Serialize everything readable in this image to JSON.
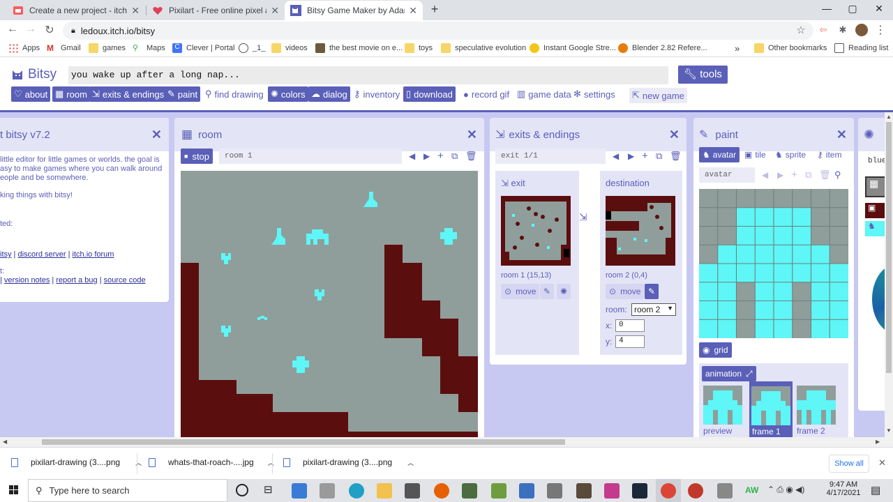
{
  "browser": {
    "tabs": [
      {
        "title": "Create a new project - itch.io",
        "icon": "itchio-icon",
        "active": false
      },
      {
        "title": "Pixilart - Free online pixel art drawing",
        "icon": "pixilart-heart-icon",
        "active": false
      },
      {
        "title": "Bitsy Game Maker by Adam Le Doux",
        "icon": "bitsy-cat-icon",
        "active": true
      }
    ],
    "url": "ledoux.itch.io/bitsy",
    "bookmarks": [
      "Apps",
      "Gmail",
      "games",
      "Maps",
      "Clever | Portal",
      "_1_",
      "videos",
      "the best movie on e...",
      "toys",
      "speculative evolution",
      "Instant Google Stre...",
      "Blender 2.82 Refere..."
    ],
    "overflow": "»",
    "other_bookmarks": "Other bookmarks",
    "reading_list": "Reading list"
  },
  "bitsy": {
    "logo": "Bitsy",
    "game_title": "you wake up after a long nap...",
    "tools": "tools",
    "menu": [
      {
        "label": "about",
        "icon": "heart-icon",
        "on": true
      },
      {
        "label": "room",
        "icon": "grid-icon",
        "on": true
      },
      {
        "label": "exits & endings",
        "icon": "exit-icon",
        "on": true
      },
      {
        "label": "paint",
        "icon": "brush-icon",
        "on": true
      },
      {
        "label": "find drawing",
        "icon": "magnify-icon",
        "on": false
      },
      {
        "label": "colors",
        "icon": "palette-icon",
        "on": true
      },
      {
        "label": "dialog",
        "icon": "speech-icon",
        "on": true
      },
      {
        "label": "inventory",
        "icon": "key-icon",
        "on": false
      },
      {
        "label": "download",
        "icon": "download-icon",
        "on": true
      },
      {
        "label": "record gif",
        "icon": "record-icon",
        "on": false
      },
      {
        "label": "game data",
        "icon": "data-icon",
        "on": false
      },
      {
        "label": "settings",
        "icon": "gear-icon",
        "on": false
      },
      {
        "label": "new game",
        "icon": "new-game-icon",
        "on": false
      }
    ]
  },
  "about": {
    "title": "t bitsy v7.2",
    "lines": [
      "little editor for little games or worlds. the goal is",
      "asy to make games where you can walk around",
      "eople and be somewhere.",
      "king things with bitsy!",
      "ted:"
    ],
    "links1": [
      "itsy",
      "discord server",
      "itch.io forum"
    ],
    "lines2": "t:",
    "links2": [
      "version notes",
      "report a bug",
      "source code"
    ]
  },
  "room": {
    "title": "room",
    "stop": "stop",
    "name": "room 1"
  },
  "exits": {
    "title": "exits & endings",
    "counter": "exit 1/1",
    "exit_label": "exit",
    "exit_room": "room 1 (15,13)",
    "dest_label": "destination",
    "dest_room": "room 2 (0,4)",
    "move": "move",
    "room_label": "room:",
    "room_value": "room 2",
    "x_label": "x:",
    "x_value": "0",
    "y_label": "y:",
    "y_value": "4"
  },
  "paint": {
    "title": "paint",
    "tabs": [
      "avatar",
      "tile",
      "sprite",
      "item"
    ],
    "name": "avatar",
    "grid": "grid",
    "animation": "animation",
    "frames": [
      "preview",
      "frame 1",
      "frame 2"
    ]
  },
  "colors_panel": {
    "label": "blue"
  },
  "downloads": {
    "files": [
      "pixilart-drawing (3....png",
      "whats-that-roach-....jpg",
      "pixilart-drawing (3....png"
    ],
    "show_all": "Show all"
  },
  "taskbar": {
    "search": "Type here to search",
    "time": "9:47 AM",
    "date": "4/17/2021"
  },
  "colors": {
    "bitsy_accent": "#5a5fb8",
    "room_bg": "#8f9e9b",
    "room_wall": "#5b0e0e",
    "room_sprite": "#5ef6f6"
  }
}
